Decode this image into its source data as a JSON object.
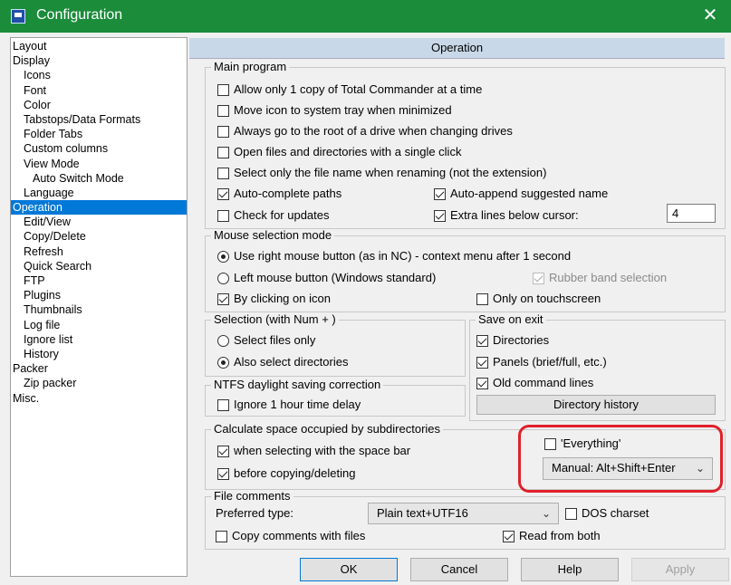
{
  "window": {
    "title": "Configuration",
    "close_label": "✕"
  },
  "tree": [
    {
      "label": "Layout",
      "level": 0
    },
    {
      "label": "Display",
      "level": 0
    },
    {
      "label": "Icons",
      "level": 1
    },
    {
      "label": "Font",
      "level": 1
    },
    {
      "label": "Color",
      "level": 1
    },
    {
      "label": "Tabstops/Data Formats",
      "level": 1
    },
    {
      "label": "Folder Tabs",
      "level": 1
    },
    {
      "label": "Custom columns",
      "level": 1
    },
    {
      "label": "View Mode",
      "level": 1
    },
    {
      "label": "Auto Switch Mode",
      "level": 2
    },
    {
      "label": "Language",
      "level": 1
    },
    {
      "label": "Operation",
      "level": 0,
      "selected": true
    },
    {
      "label": "Edit/View",
      "level": 1
    },
    {
      "label": "Copy/Delete",
      "level": 1
    },
    {
      "label": "Refresh",
      "level": 1
    },
    {
      "label": "Quick Search",
      "level": 1
    },
    {
      "label": "FTP",
      "level": 1
    },
    {
      "label": "Plugins",
      "level": 1
    },
    {
      "label": "Thumbnails",
      "level": 1
    },
    {
      "label": "Log file",
      "level": 1
    },
    {
      "label": "Ignore list",
      "level": 1
    },
    {
      "label": "History",
      "level": 1
    },
    {
      "label": "Packer",
      "level": 0
    },
    {
      "label": "Zip packer",
      "level": 1
    },
    {
      "label": "Misc.",
      "level": 0
    }
  ],
  "header": "Operation",
  "main_program": {
    "legend": "Main program",
    "allow_one_copy": "Allow only 1 copy of Total Commander at a time",
    "tray_icon": "Move icon to system tray when minimized",
    "go_root": "Always go to the root of a drive when changing drives",
    "single_click": "Open files and directories with a single click",
    "select_name_only": "Select only the file name when renaming (not the extension)",
    "autocomplete": "Auto-complete paths",
    "auto_append": "Auto-append suggested name",
    "check_updates": "Check for updates",
    "extra_lines": "Extra lines below cursor:",
    "extra_lines_value": "4"
  },
  "mouse": {
    "legend": "Mouse selection mode",
    "right_button": "Use right mouse button (as in NC) - context menu after 1 second",
    "left_button": "Left mouse button (Windows standard)",
    "rubber_band": "Rubber band selection",
    "by_icon": "By clicking on icon",
    "touchscreen": "Only on touchscreen"
  },
  "selection": {
    "legend": "Selection (with Num + )",
    "files_only": "Select files only",
    "also_dirs": "Also select directories"
  },
  "save_on_exit": {
    "legend": "Save on exit",
    "directories": "Directories",
    "panels": "Panels (brief/full, etc.)",
    "old_cmd": "Old command lines",
    "dir_history_button": "Directory history"
  },
  "ntfs": {
    "legend": "NTFS daylight saving correction",
    "ignore": "Ignore 1 hour time delay"
  },
  "calc_space": {
    "legend": "Calculate space occupied by subdirectories",
    "space_bar": "when selecting with the space bar",
    "before_copy": "before copying/deleting",
    "everything": "'Everything'",
    "everything_mode": "Manual: Alt+Shift+Enter"
  },
  "comments": {
    "legend": "File comments",
    "preferred_label": "Preferred type:",
    "preferred_value": "Plain text+UTF16",
    "dos_charset": "DOS charset",
    "copy_comments": "Copy comments with files",
    "read_both": "Read from both"
  },
  "buttons": {
    "ok": "OK",
    "cancel": "Cancel",
    "help": "Help",
    "apply": "Apply"
  },
  "colors": {
    "titlebar": "#1a8c3a",
    "selection": "#0078d7",
    "header": "#c8d8e8",
    "highlight": "#e0202a"
  }
}
